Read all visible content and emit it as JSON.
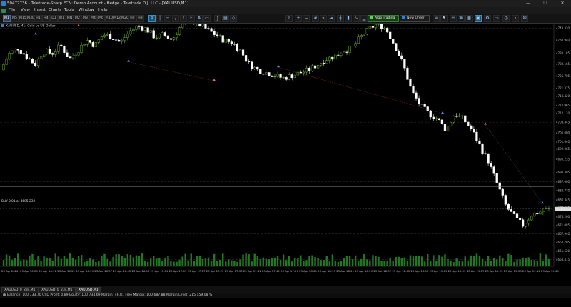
{
  "window": {
    "title": "50477736 - Teletrade-Sharp ECN: Demo Account - Hedge - Teletrade D.J. LLC - [XAUUSD,M1]",
    "controls": [
      "—",
      "☐",
      "✕"
    ]
  },
  "menu": [
    "File",
    "View",
    "Insert",
    "Charts",
    "Tools",
    "Window",
    "Help"
  ],
  "timeframes": {
    "items": [
      "M1",
      "M5",
      "M15",
      "M30",
      "H1",
      "H4",
      "D1",
      "W1",
      "MN",
      "M2",
      "M3",
      "M4",
      "M6",
      "M10",
      "M12",
      "M20",
      "H2",
      "H3"
    ],
    "active": "M1"
  },
  "toolbar": {
    "algo_label": "Algo Trading",
    "new_order_label": "New Order"
  },
  "chart": {
    "symbol_label": "XAUUSD,M1:  Gold vs US Dollar",
    "order_label": "BUY 0.01 at 4685.230",
    "bg": "#000000",
    "bull_color": "#7ed321",
    "bear_color": "#ffffff"
  },
  "chart_data": {
    "type": "candlestick",
    "price_labels": [
      "4743.330",
      "4738.940",
      "4734.185",
      "4730.165",
      "4725.705",
      "4721.375",
      "4718.420",
      "4714.965",
      "4712.110",
      "4708.845",
      "4705.000",
      "4701.640",
      "4699.065",
      "4695.235",
      "4690.405",
      "4687.000",
      "4683.770",
      "4680.345",
      "4677.405",
      "4674.200",
      "4671.085",
      "4667.940",
      "4664.705",
      "4661.620",
      "4658.475"
    ],
    "ylim": [
      4656.0,
      4745.0
    ],
    "time_labels": [
      "23 Apr 2026",
      "23 Apr 16:03",
      "23 Apr 16:11",
      "23 Apr 16:22",
      "23 Apr 16:29",
      "23 Apr 16:37",
      "23 Apr 16:45",
      "23 Apr 16:53",
      "23 Apr 17:01",
      "23 Apr 17:09",
      "23 Apr 17:17",
      "23 Apr 17:25",
      "23 Apr 17:33",
      "23 Apr 17:41",
      "23 Apr 17:49",
      "23 Apr 17:57",
      "23 Apr 18:05",
      "23 Apr 18:13",
      "23 Apr 18:21",
      "23 Apr 18:29",
      "23 Apr 18:37",
      "23 Apr 18:45",
      "23 Apr 18:53",
      "23 Apr 19:01",
      "23 Apr 19:09",
      "23 Apr 19:17",
      "23 Apr 19:25",
      "23 Apr 19:33",
      "23 Apr 19:41",
      "23 Apr 19:49"
    ],
    "close_path": [
      4728,
      4734,
      4736,
      4733,
      4730,
      4735,
      4734,
      4737,
      4732,
      4735,
      4739,
      4737,
      4741,
      4740,
      4738,
      4742,
      4744,
      4743,
      4740,
      4741,
      4739,
      4744,
      4746,
      4745,
      4743,
      4741,
      4739,
      4738,
      4735,
      4730,
      4728,
      4727,
      4726,
      4725,
      4726,
      4727,
      4728,
      4730,
      4732,
      4733,
      4735,
      4736,
      4740,
      4743,
      4745,
      4743,
      4737,
      4730,
      4720,
      4715,
      4712,
      4710,
      4706,
      4712,
      4710,
      4706,
      4700,
      4694,
      4686,
      4678,
      4674,
      4671,
      4675,
      4676,
      4677
    ],
    "current_price": 4677.0,
    "order_price": 4685.23
  },
  "tabs": [
    "XAUUSD_0_23s,M1",
    "XAUUSD_0_23s,M1",
    "XAUUSD,M1"
  ],
  "status": {
    "text": "Balance: 100 733.70 USD   Profit: 0.89   Equity: 100 734.69   Margin: 46.81   Free Margin: 100 687.88   Margin Level: 215 159.08 %"
  }
}
